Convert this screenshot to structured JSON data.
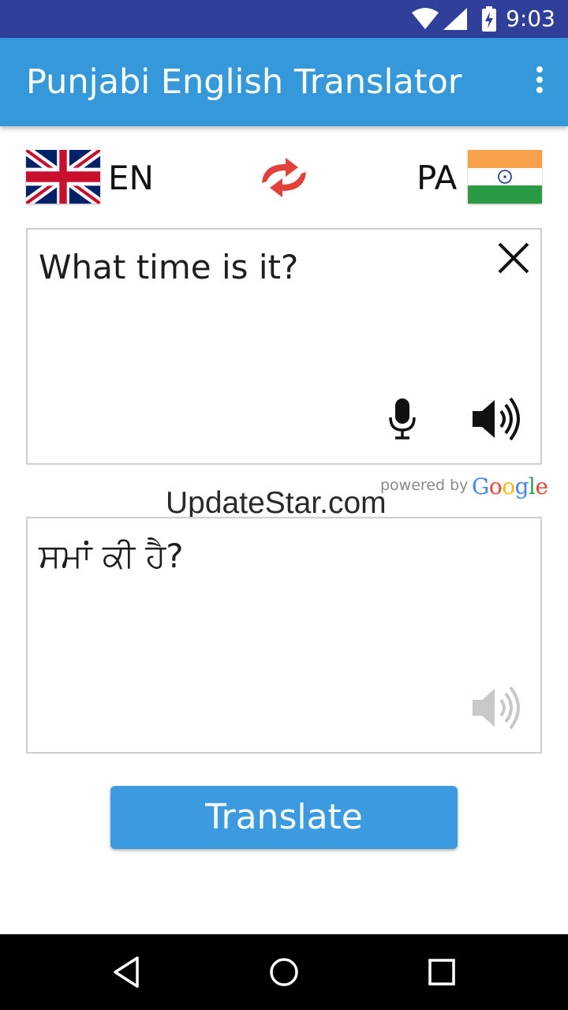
{
  "status_bar": {
    "time": "9:03",
    "icons": [
      "wifi-icon",
      "signal-icon",
      "battery-charging-icon"
    ]
  },
  "app_bar": {
    "title": "Punjabi English Translator",
    "menu_icon": "more-vert-icon"
  },
  "languages": {
    "source_code": "EN",
    "source_flag": "uk-flag-icon",
    "target_code": "PA",
    "target_flag": "india-flag-icon",
    "swap_icon": "swap-arrows-icon"
  },
  "input": {
    "text": "What time is it?",
    "clear_icon": "close-icon",
    "mic_icon": "microphone-icon",
    "speak_icon": "speaker-icon"
  },
  "attribution": {
    "powered_by": "powered by",
    "brand": "Google",
    "brand_colors": [
      "#4285F4",
      "#EA4335",
      "#FBBC05",
      "#4285F4",
      "#34A853",
      "#EA4335"
    ]
  },
  "watermark": "UpdateStar.com",
  "output": {
    "text": "ਸਮਾਂ ਕੀ ਹੈ?",
    "speak_icon": "speaker-icon-disabled"
  },
  "actions": {
    "translate_label": "Translate"
  },
  "nav_bar": {
    "buttons": [
      "back-icon",
      "home-icon",
      "recents-icon"
    ]
  },
  "colors": {
    "status_bar": "#2f3f9a",
    "app_bar": "#3498db",
    "button": "#3c9ae0",
    "swap_icon": "#e2403a"
  }
}
